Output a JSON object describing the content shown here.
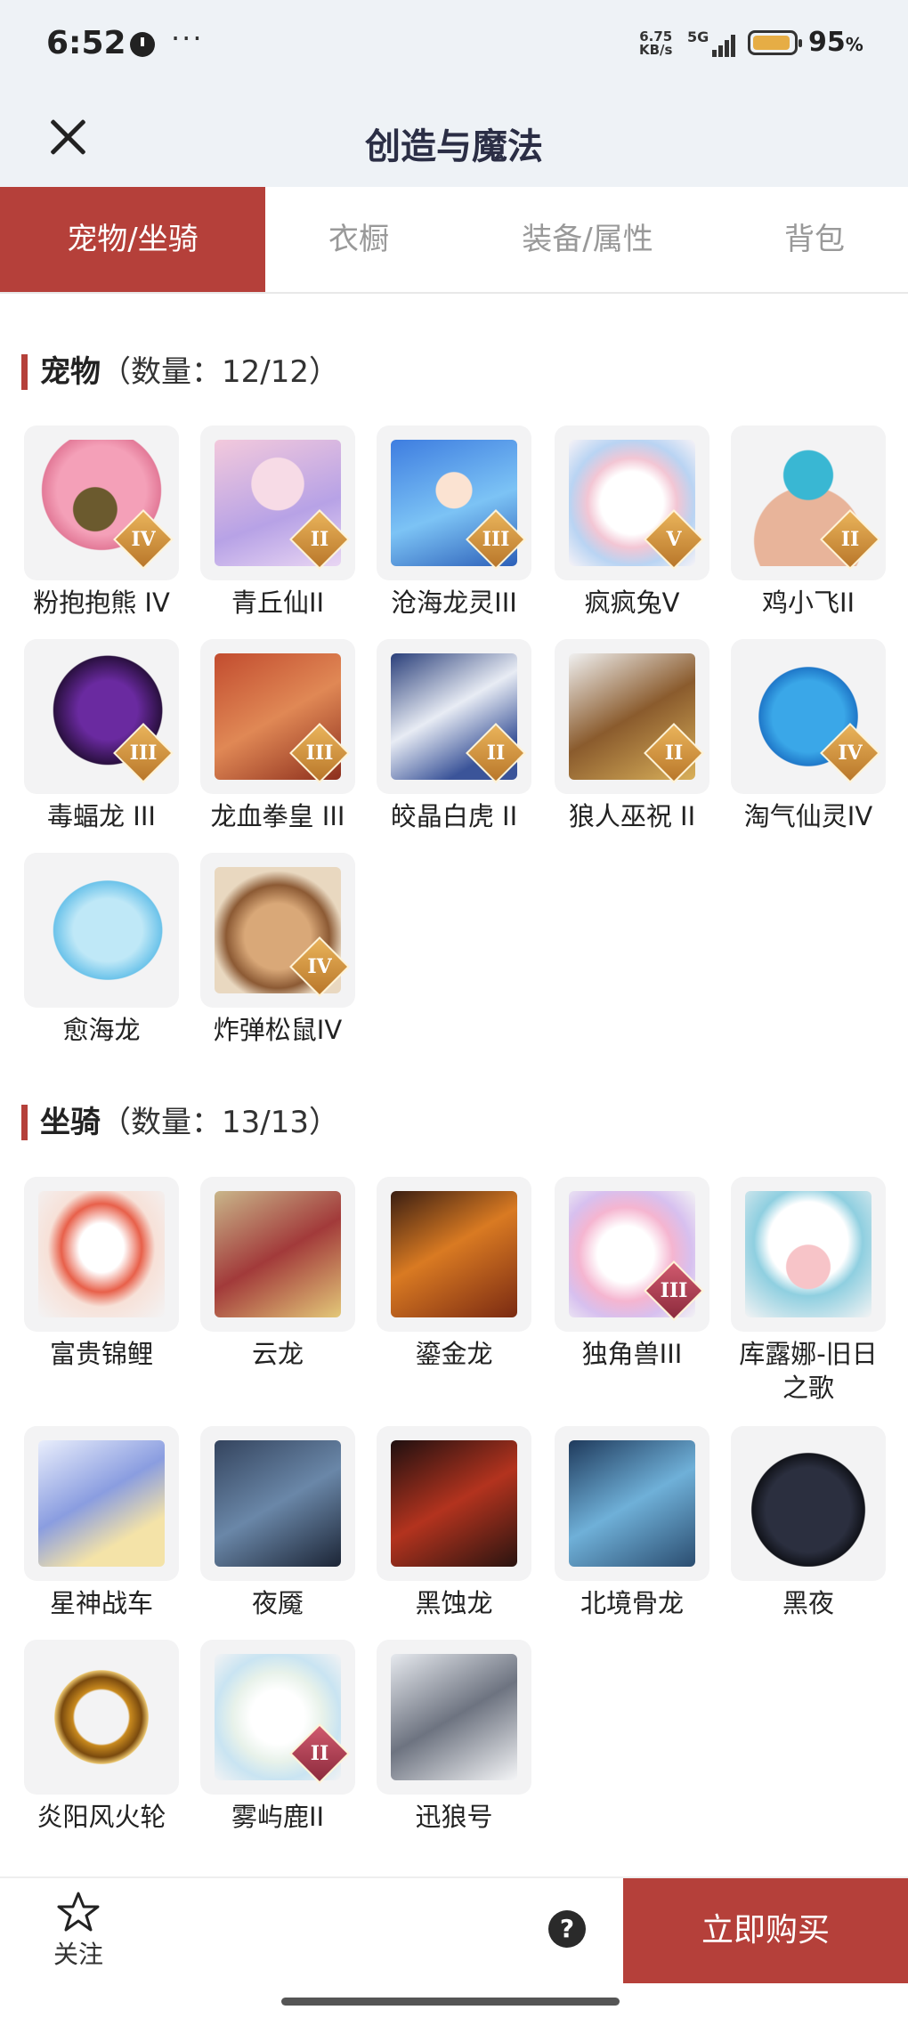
{
  "status_bar": {
    "time": "6:52",
    "more": "···",
    "net_speed_value": "6.75",
    "net_speed_unit": "KB/s",
    "network": "5G",
    "battery_level": 0.95,
    "battery_text": "95",
    "battery_unit": "%"
  },
  "header": {
    "title": "创造与魔法",
    "close_icon": "close-icon"
  },
  "tabs": [
    {
      "label": "宠物/坐骑",
      "active": true
    },
    {
      "label": "衣橱",
      "active": false
    },
    {
      "label": "装备/属性",
      "active": false
    },
    {
      "label": "背包",
      "active": false
    }
  ],
  "pets": {
    "title": "宠物",
    "count": "（数量：12/12）",
    "items": [
      {
        "name": "粉抱抱熊 IV",
        "badge": "IV"
      },
      {
        "name": "青丘仙II",
        "badge": "II"
      },
      {
        "name": "沧海龙灵III",
        "badge": "III"
      },
      {
        "name": "疯疯兔V",
        "badge": "V"
      },
      {
        "name": "鸡小飞II",
        "badge": "II"
      },
      {
        "name": "毒蝠龙 III",
        "badge": "III"
      },
      {
        "name": "龙血拳皇 III",
        "badge": "III"
      },
      {
        "name": "皎晶白虎 II",
        "badge": "II"
      },
      {
        "name": "狼人巫祝 II",
        "badge": "II"
      },
      {
        "name": "淘气仙灵IV",
        "badge": "IV"
      },
      {
        "name": "愈海龙",
        "badge": ""
      },
      {
        "name": "炸弹松鼠IV",
        "badge": "IV"
      }
    ]
  },
  "mounts": {
    "title": "坐骑",
    "count": "（数量：13/13）",
    "items": [
      {
        "name": "富贵锦鲤",
        "badge": ""
      },
      {
        "name": "云龙",
        "badge": ""
      },
      {
        "name": "鎏金龙",
        "badge": ""
      },
      {
        "name": "独角兽III",
        "badge": "III"
      },
      {
        "name": "库露娜-旧日之歌",
        "badge": ""
      },
      {
        "name": "星神战车",
        "badge": ""
      },
      {
        "name": "夜魇",
        "badge": ""
      },
      {
        "name": "黑蚀龙",
        "badge": ""
      },
      {
        "name": "北境骨龙",
        "badge": ""
      },
      {
        "name": "黑夜",
        "badge": ""
      },
      {
        "name": "炎阳风火轮",
        "badge": ""
      },
      {
        "name": "雾屿鹿II",
        "badge": "II"
      },
      {
        "name": "迅狼号",
        "badge": ""
      }
    ]
  },
  "bottom_bar": {
    "follow_label": "关注",
    "help": "?",
    "buy_label": "立即购买"
  },
  "colors": {
    "accent": "#b5403a",
    "header_bg": "#eef2f6",
    "tile_bg": "#f3f3f4"
  }
}
